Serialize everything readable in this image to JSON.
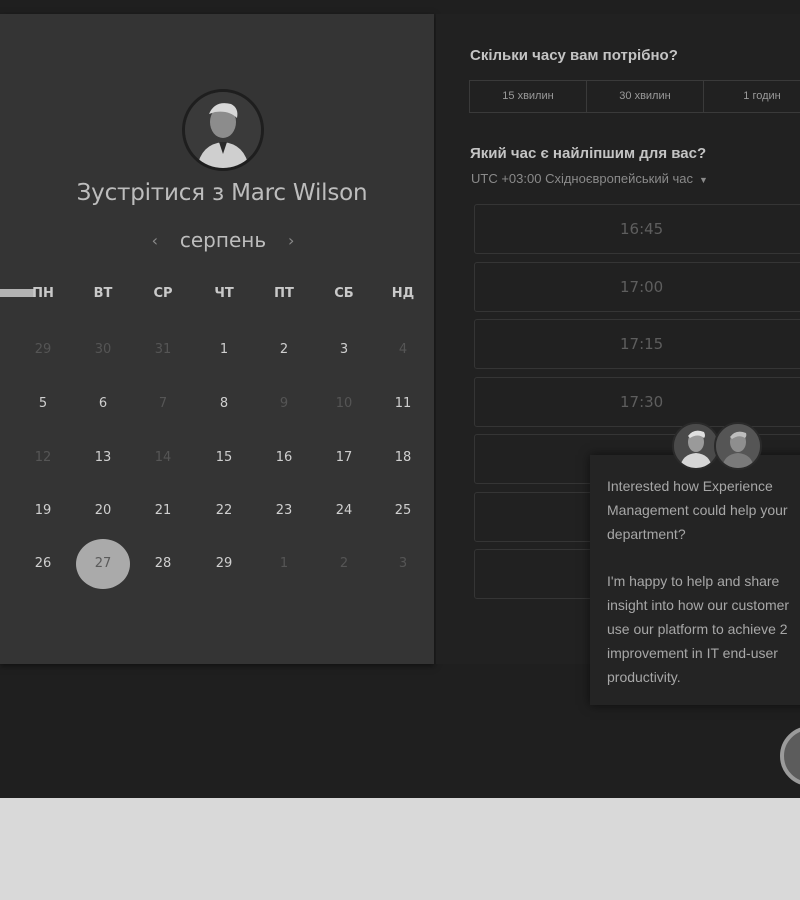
{
  "host": {
    "title": "Зустрітися з Marc Wilson"
  },
  "calendar": {
    "month": "серпень",
    "prev_arrow": "‹",
    "next_arrow": "›",
    "weekdays": [
      "ПН",
      "ВТ",
      "СР",
      "ЧТ",
      "ПТ",
      "СБ",
      "НД"
    ],
    "weeks": [
      [
        {
          "d": "29",
          "s": "dim"
        },
        {
          "d": "30",
          "s": "dim"
        },
        {
          "d": "31",
          "s": "dim"
        },
        {
          "d": "1",
          "s": "avail"
        },
        {
          "d": "2",
          "s": "avail"
        },
        {
          "d": "3",
          "s": "avail"
        },
        {
          "d": "4",
          "s": "dim"
        }
      ],
      [
        {
          "d": "5",
          "s": "avail"
        },
        {
          "d": "6",
          "s": "avail"
        },
        {
          "d": "7",
          "s": "dim"
        },
        {
          "d": "8",
          "s": "avail"
        },
        {
          "d": "9",
          "s": "dim"
        },
        {
          "d": "10",
          "s": "dim"
        },
        {
          "d": "11",
          "s": "avail"
        }
      ],
      [
        {
          "d": "12",
          "s": "dim"
        },
        {
          "d": "13",
          "s": "avail"
        },
        {
          "d": "14",
          "s": "dim"
        },
        {
          "d": "15",
          "s": "avail"
        },
        {
          "d": "16",
          "s": "avail"
        },
        {
          "d": "17",
          "s": "avail"
        },
        {
          "d": "18",
          "s": "avail"
        }
      ],
      [
        {
          "d": "19",
          "s": "avail"
        },
        {
          "d": "20",
          "s": "avail"
        },
        {
          "d": "21",
          "s": "avail"
        },
        {
          "d": "22",
          "s": "avail"
        },
        {
          "d": "23",
          "s": "avail"
        },
        {
          "d": "24",
          "s": "avail"
        },
        {
          "d": "25",
          "s": "avail"
        }
      ],
      [
        {
          "d": "26",
          "s": "avail"
        },
        {
          "d": "27",
          "s": "selected"
        },
        {
          "d": "28",
          "s": "avail"
        },
        {
          "d": "29",
          "s": "avail"
        },
        {
          "d": "1",
          "s": "dim"
        },
        {
          "d": "2",
          "s": "dim"
        },
        {
          "d": "3",
          "s": "dim"
        }
      ]
    ]
  },
  "duration": {
    "question": "Скільки часу вам потрібно?",
    "options": [
      "15 хвилин",
      "30 хвилин",
      "1 годин"
    ]
  },
  "time": {
    "question": "Який час є найліпшим для вас?",
    "timezone": "UTC +03:00 Східноєвропейський час",
    "slots": [
      "16:45",
      "17:00",
      "17:15",
      "17:30",
      "",
      "",
      ""
    ]
  },
  "chat": {
    "lines": [
      "Interested how Experience",
      "Management could help your",
      "department?",
      "",
      "I'm happy to help and share",
      "insight into how our customer",
      "use our platform to achieve 2",
      "improvement in IT end-user",
      "productivity."
    ]
  },
  "colors": {
    "selected_day": "#aaaaaa",
    "available_day": "#cfcfcf",
    "unavailable_day": "#555555"
  },
  "icons": {
    "prev_month": "chevron-left-icon",
    "next_month": "chevron-right-icon",
    "timezone_caret": "caret-down-icon"
  }
}
